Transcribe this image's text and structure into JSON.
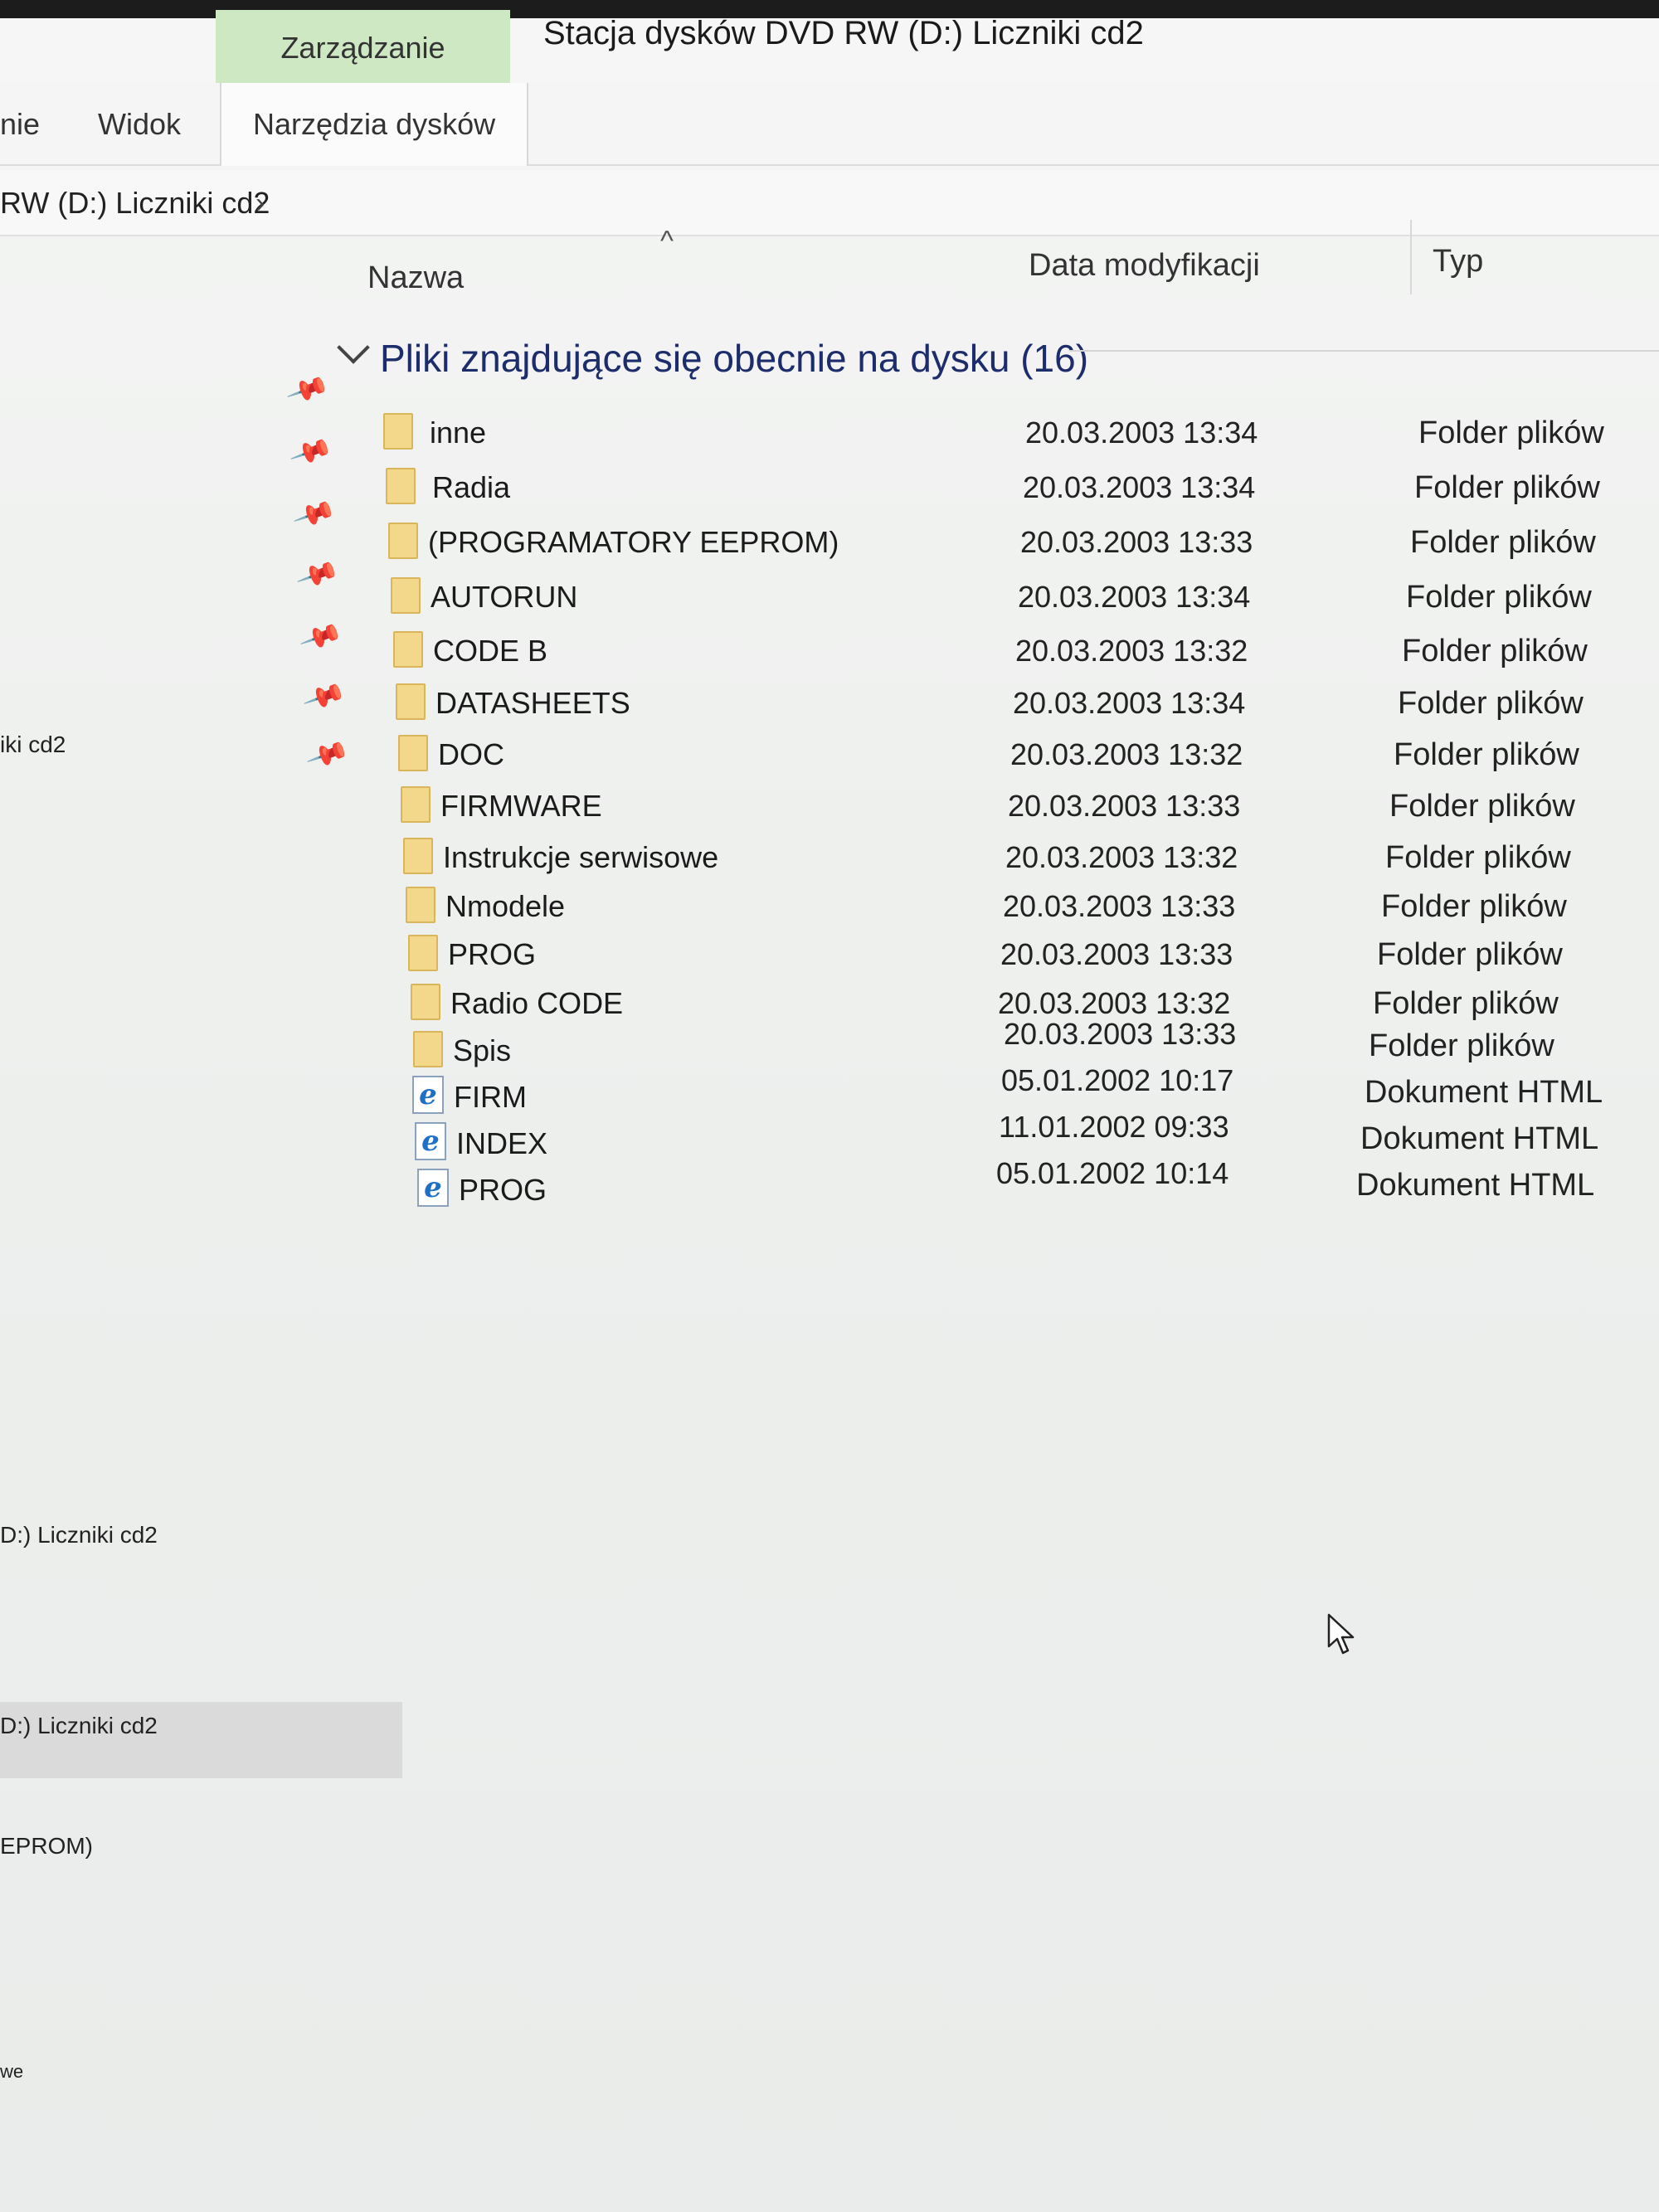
{
  "ribbon": {
    "manage_tab": "Zarządzanie",
    "window_title": "Stacja dysków DVD RW (D:) Liczniki cd2",
    "tabs": [
      "nie",
      "Widok",
      "Narzędzia dysków"
    ]
  },
  "address": {
    "path": "RW (D:) Liczniki cd2",
    "chevron": "›"
  },
  "columns": {
    "name": "Nazwa",
    "sort_indicator": "^",
    "date": "Data modyfikacji",
    "type": "Typ"
  },
  "group": {
    "label": "Pliki znajdujące się obecnie na dysku (16)"
  },
  "files": [
    {
      "name": "inne",
      "date": "20.03.2003 13:34",
      "type": "Folder plików",
      "icon": "folder-icon"
    },
    {
      "name": "Radia",
      "date": "20.03.2003 13:34",
      "type": "Folder plików",
      "icon": "folder-icon"
    },
    {
      "name": "(PROGRAMATORY  EEPROM)",
      "date": "20.03.2003 13:33",
      "type": "Folder plików",
      "icon": "folder-icon"
    },
    {
      "name": "AUTORUN",
      "date": "20.03.2003 13:34",
      "type": "Folder plików",
      "icon": "folder-icon"
    },
    {
      "name": "CODE B",
      "date": "20.03.2003 13:32",
      "type": "Folder plików",
      "icon": "folder-icon"
    },
    {
      "name": "DATASHEETS",
      "date": "20.03.2003 13:34",
      "type": "Folder plików",
      "icon": "folder-icon"
    },
    {
      "name": "DOC",
      "date": "20.03.2003 13:32",
      "type": "Folder plików",
      "icon": "folder-icon"
    },
    {
      "name": "FIRMWARE",
      "date": "20.03.2003 13:33",
      "type": "Folder plików",
      "icon": "folder-icon"
    },
    {
      "name": "Instrukcje serwisowe",
      "date": "20.03.2003 13:32",
      "type": "Folder plików",
      "icon": "folder-icon"
    },
    {
      "name": "Nmodele",
      "date": "20.03.2003 13:33",
      "type": "Folder plików",
      "icon": "folder-icon"
    },
    {
      "name": "PROG",
      "date": "20.03.2003 13:33",
      "type": "Folder plików",
      "icon": "folder-icon"
    },
    {
      "name": "Radio CODE",
      "date": "20.03.2003 13:32",
      "type": "Folder plików",
      "icon": "folder-icon"
    },
    {
      "name": "Spis",
      "date": "20.03.2003 13:33",
      "type": "Folder plików",
      "icon": "folder-icon"
    },
    {
      "name": "FIRM",
      "date": "05.01.2002 10:17",
      "type": "Dokument HTML",
      "icon": "html-document-icon"
    },
    {
      "name": "INDEX",
      "date": "11.01.2002 09:33",
      "type": "Dokument HTML",
      "icon": "html-document-icon"
    },
    {
      "name": "PROG",
      "date": "05.01.2002 10:14",
      "type": "Dokument HTML",
      "icon": "html-document-icon"
    }
  ],
  "sidebar": {
    "quick_access_item": "iki cd2",
    "recent_1": "D:) Liczniki cd2",
    "recent_2": "D:) Liczniki cd2",
    "recent_3": "EPROM)",
    "recent_4": "we"
  },
  "colors": {
    "manage_tab_bg": "#cfe8c4",
    "folder_icon": "#f3d78a",
    "group_header_text": "#1d2c6b",
    "html_icon": "#1f6fc5"
  }
}
